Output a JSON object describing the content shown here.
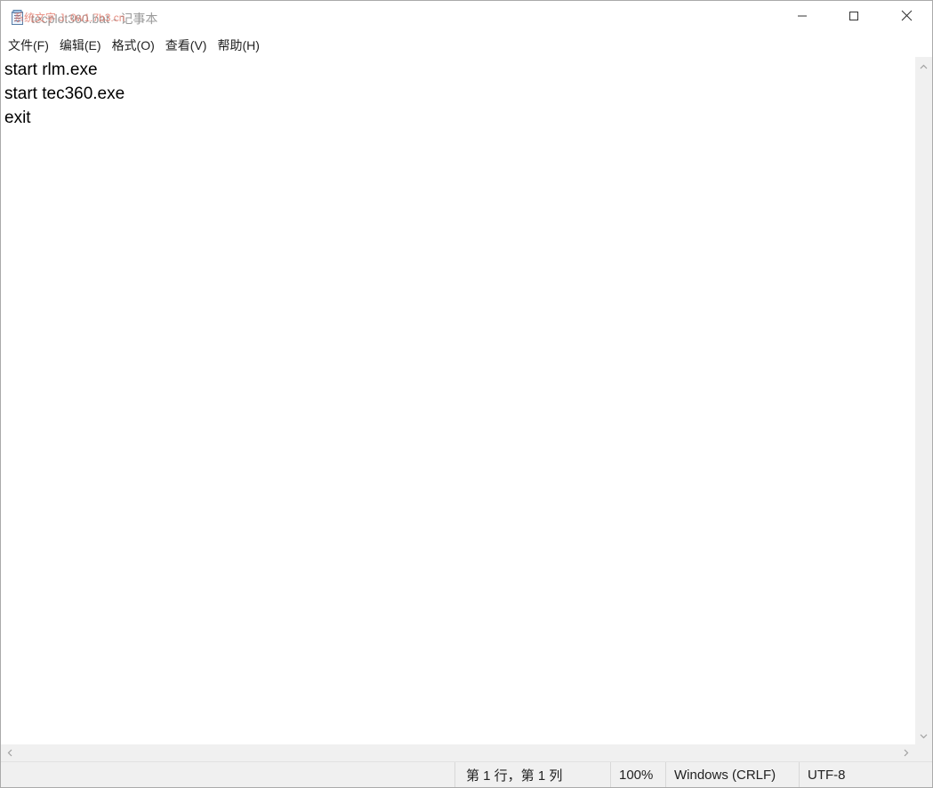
{
  "window": {
    "title": "tecplot360.bat - 记事本",
    "watermark": "系统文字 J: 0w1.7b3.cn"
  },
  "titlebar": {
    "minimize_icon": "minimize-icon",
    "maximize_icon": "maximize-icon",
    "close_icon": "close-icon"
  },
  "menu": {
    "items": [
      {
        "label": "文件(F)"
      },
      {
        "label": "编辑(E)"
      },
      {
        "label": "格式(O)"
      },
      {
        "label": "查看(V)"
      },
      {
        "label": "帮助(H)"
      }
    ]
  },
  "editor": {
    "lines": [
      "start rlm.exe",
      "start tec360.exe",
      "exit"
    ]
  },
  "statusbar": {
    "position": "第 1 行，第 1 列",
    "zoom": "100%",
    "line_ending": "Windows (CRLF)",
    "encoding": "UTF-8"
  },
  "colors": {
    "title_text": "#9a9a9a",
    "watermark": "#e06a5a",
    "chrome_bg": "#f0f0f0",
    "text": "#000000"
  }
}
